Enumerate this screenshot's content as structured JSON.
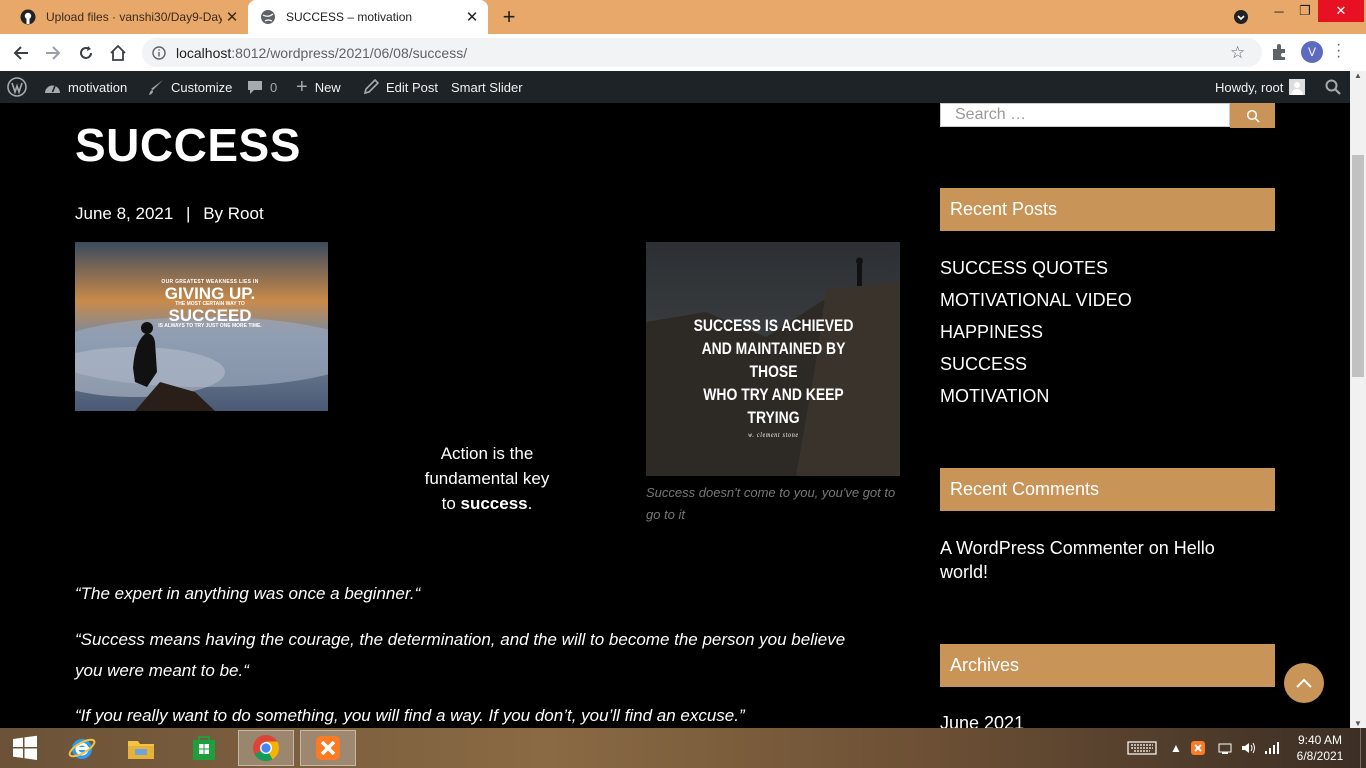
{
  "browser": {
    "tabs": [
      {
        "title": "Upload files · vanshi30/Day9-Day",
        "active": false
      },
      {
        "title": "SUCCESS – motivation",
        "active": true
      }
    ],
    "new_tab": "+",
    "url_host": "localhost",
    "url_path": ":8012/wordpress/2021/06/08/success/",
    "profile_initial": "V",
    "window_controls": [
      "minimize",
      "restore",
      "close"
    ]
  },
  "admin_bar": {
    "site_name": "motivation",
    "customize": "Customize",
    "comments_count": "0",
    "new": "New",
    "edit_post": "Edit Post",
    "smart_slider": "Smart Slider",
    "howdy": "Howdy, root"
  },
  "post": {
    "title": "SUCCESS",
    "date": "June 8, 2021",
    "separator": "|",
    "author": "By Root",
    "image1_text": {
      "line1": "OUR GREATEST WEAKNESS LIES IN",
      "line2": "GIVING UP.",
      "line3": "THE MOST CERTAIN WAY TO",
      "line4": "SUCCEED",
      "line5": "IS ALWAYS TO TRY JUST ONE MORE TIME."
    },
    "image2_text": {
      "line1": "SUCCESS IS ACHIEVED",
      "line2": "AND MAINTAINED BY THOSE",
      "line3": "WHO TRY AND KEEP",
      "line4": "TRYING",
      "line5": "w. clement stone"
    },
    "center_text_1": "Action is the",
    "center_text_2": "fundamental key",
    "center_text_3_pre": "to ",
    "center_text_3_bold": "success",
    "center_text_3_post": ".",
    "caption": "Success doesn't come to you, you've got to go to it",
    "quotes": [
      "“The expert in anything was once a beginner.“",
      "“Success means having the courage, the determination, and the will to become the person you believe you were meant to be.“",
      "“If you really want to do something, you will find a way. If you don’t, you’ll find an excuse.”"
    ]
  },
  "sidebar": {
    "search_placeholder": "Search …",
    "recent_posts_title": "Recent Posts",
    "recent_posts": [
      "SUCCESS QUOTES",
      "MOTIVATIONAL VIDEO",
      "HAPPINESS",
      "SUCCESS",
      "MOTIVATION"
    ],
    "recent_comments_title": "Recent Comments",
    "comment_author": "A WordPress Commenter",
    "comment_on": " on ",
    "comment_post": "Hello world!",
    "archives_title": "Archives",
    "archive_item": "June 2021"
  },
  "taskbar": {
    "time": "9:40 AM",
    "date": "6/8/2021"
  },
  "colors": {
    "accent": "#c99458",
    "tab_bar": "#e8a86a",
    "admin_bar": "#1d2327"
  }
}
